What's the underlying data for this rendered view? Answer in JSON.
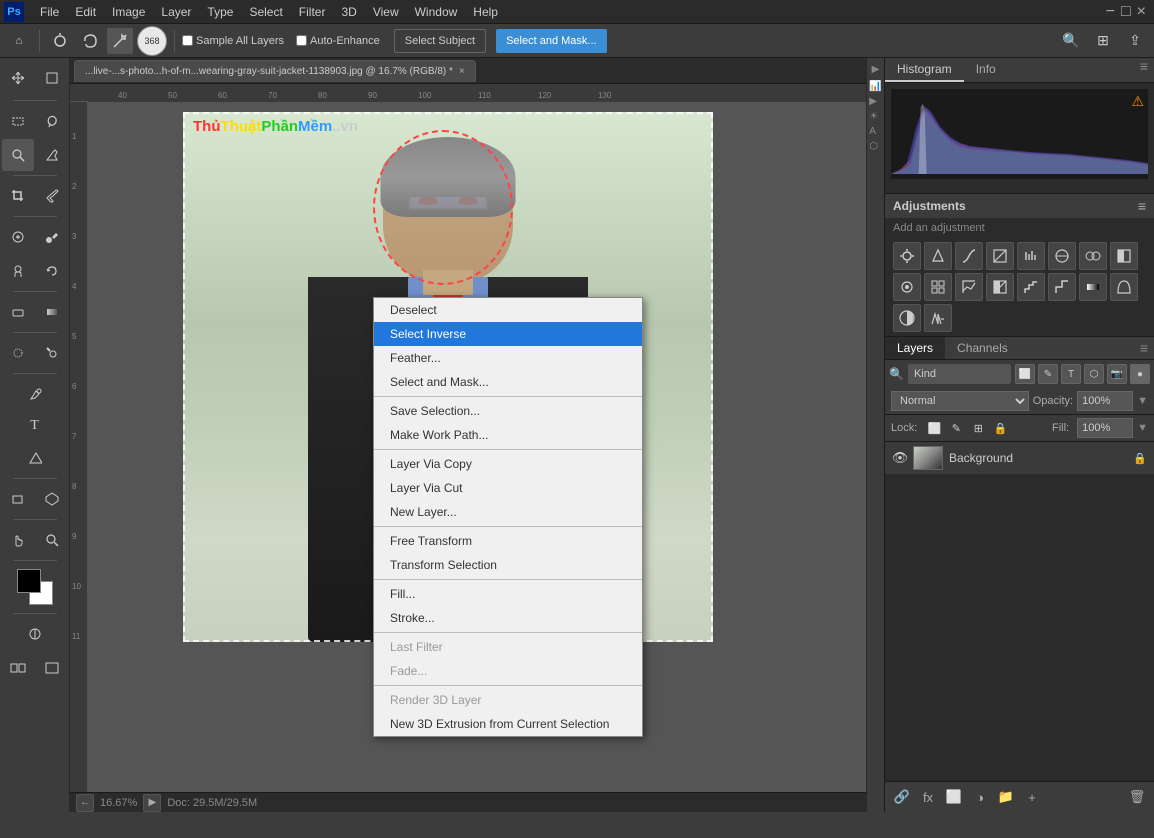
{
  "app": {
    "title": "Adobe Photoshop"
  },
  "menubar": {
    "items": [
      "PS",
      "File",
      "Edit",
      "Image",
      "Layer",
      "Type",
      "Select",
      "Filter",
      "3D",
      "View",
      "Window",
      "Help"
    ]
  },
  "toolbar": {
    "zoom_label": "368",
    "sample_all_layers": "Sample All Layers",
    "auto_enhance": "Auto-Enhance",
    "select_subject_label": "Select Subject",
    "select_mask_label": "Select and Mask..."
  },
  "tab": {
    "filename": "...live-...s-photo...h-of-m...wearing-gray-suit-jacket-1138903.jpg @ 16.7% (RGB/8) *",
    "close": "×"
  },
  "context_menu": {
    "items": [
      {
        "label": "Deselect",
        "shortcut": "",
        "disabled": false,
        "active": false,
        "separator_after": false
      },
      {
        "label": "Select Inverse",
        "shortcut": "",
        "disabled": false,
        "active": true,
        "separator_after": false
      },
      {
        "label": "Feather...",
        "shortcut": "",
        "disabled": false,
        "active": false,
        "separator_after": false
      },
      {
        "label": "Select and Mask...",
        "shortcut": "",
        "disabled": false,
        "active": false,
        "separator_after": true
      },
      {
        "label": "Save Selection...",
        "shortcut": "",
        "disabled": false,
        "active": false,
        "separator_after": false
      },
      {
        "label": "Make Work Path...",
        "shortcut": "",
        "disabled": false,
        "active": false,
        "separator_after": true
      },
      {
        "label": "Layer Via Copy",
        "shortcut": "",
        "disabled": false,
        "active": false,
        "separator_after": false
      },
      {
        "label": "Layer Via Cut",
        "shortcut": "",
        "disabled": false,
        "active": false,
        "separator_after": false
      },
      {
        "label": "New Layer...",
        "shortcut": "",
        "disabled": false,
        "active": false,
        "separator_after": true
      },
      {
        "label": "Free Transform",
        "shortcut": "",
        "disabled": false,
        "active": false,
        "separator_after": false
      },
      {
        "label": "Transform Selection",
        "shortcut": "",
        "disabled": false,
        "active": false,
        "separator_after": true
      },
      {
        "label": "Fill...",
        "shortcut": "",
        "disabled": false,
        "active": false,
        "separator_after": false
      },
      {
        "label": "Stroke...",
        "shortcut": "",
        "disabled": false,
        "active": false,
        "separator_after": true
      },
      {
        "label": "Last Filter",
        "shortcut": "",
        "disabled": true,
        "active": false,
        "separator_after": false
      },
      {
        "label": "Fade...",
        "shortcut": "",
        "disabled": true,
        "active": false,
        "separator_after": true
      },
      {
        "label": "Render 3D Layer",
        "shortcut": "",
        "disabled": true,
        "active": false,
        "separator_after": false
      },
      {
        "label": "New 3D Extrusion from Current Selection",
        "shortcut": "",
        "disabled": false,
        "active": false,
        "separator_after": false
      }
    ]
  },
  "histogram": {
    "tab_histogram": "Histogram",
    "tab_info": "Info"
  },
  "adjustments": {
    "title": "Adjustments",
    "subtitle": "Add an adjustment",
    "buttons": [
      "☀",
      "📊",
      "🎨",
      "◻",
      "△",
      "▽",
      "◈",
      "⊕",
      "📷",
      "🔊",
      "◑",
      "⊞",
      "◻",
      "✎",
      "📷",
      "🔊",
      "◑",
      "⊞"
    ]
  },
  "layers": {
    "tab_layers": "Layers",
    "tab_channels": "Channels",
    "search_placeholder": "Kind",
    "blend_mode": "Normal",
    "opacity_label": "Opacity:",
    "opacity_value": "100%",
    "fill_label": "Fill:",
    "fill_value": "100%",
    "lock_label": "Lock:",
    "items": [
      {
        "name": "Background",
        "visible": true,
        "locked": true
      }
    ]
  },
  "status": {
    "zoom": "16.67%",
    "doc_size": "Doc: 29.5M/29.5M"
  },
  "watermark": {
    "thu": "Thủ",
    "thuat": "Thuật",
    "phan": "Phần",
    "mem": "Mềm",
    "vn": ".vn"
  }
}
